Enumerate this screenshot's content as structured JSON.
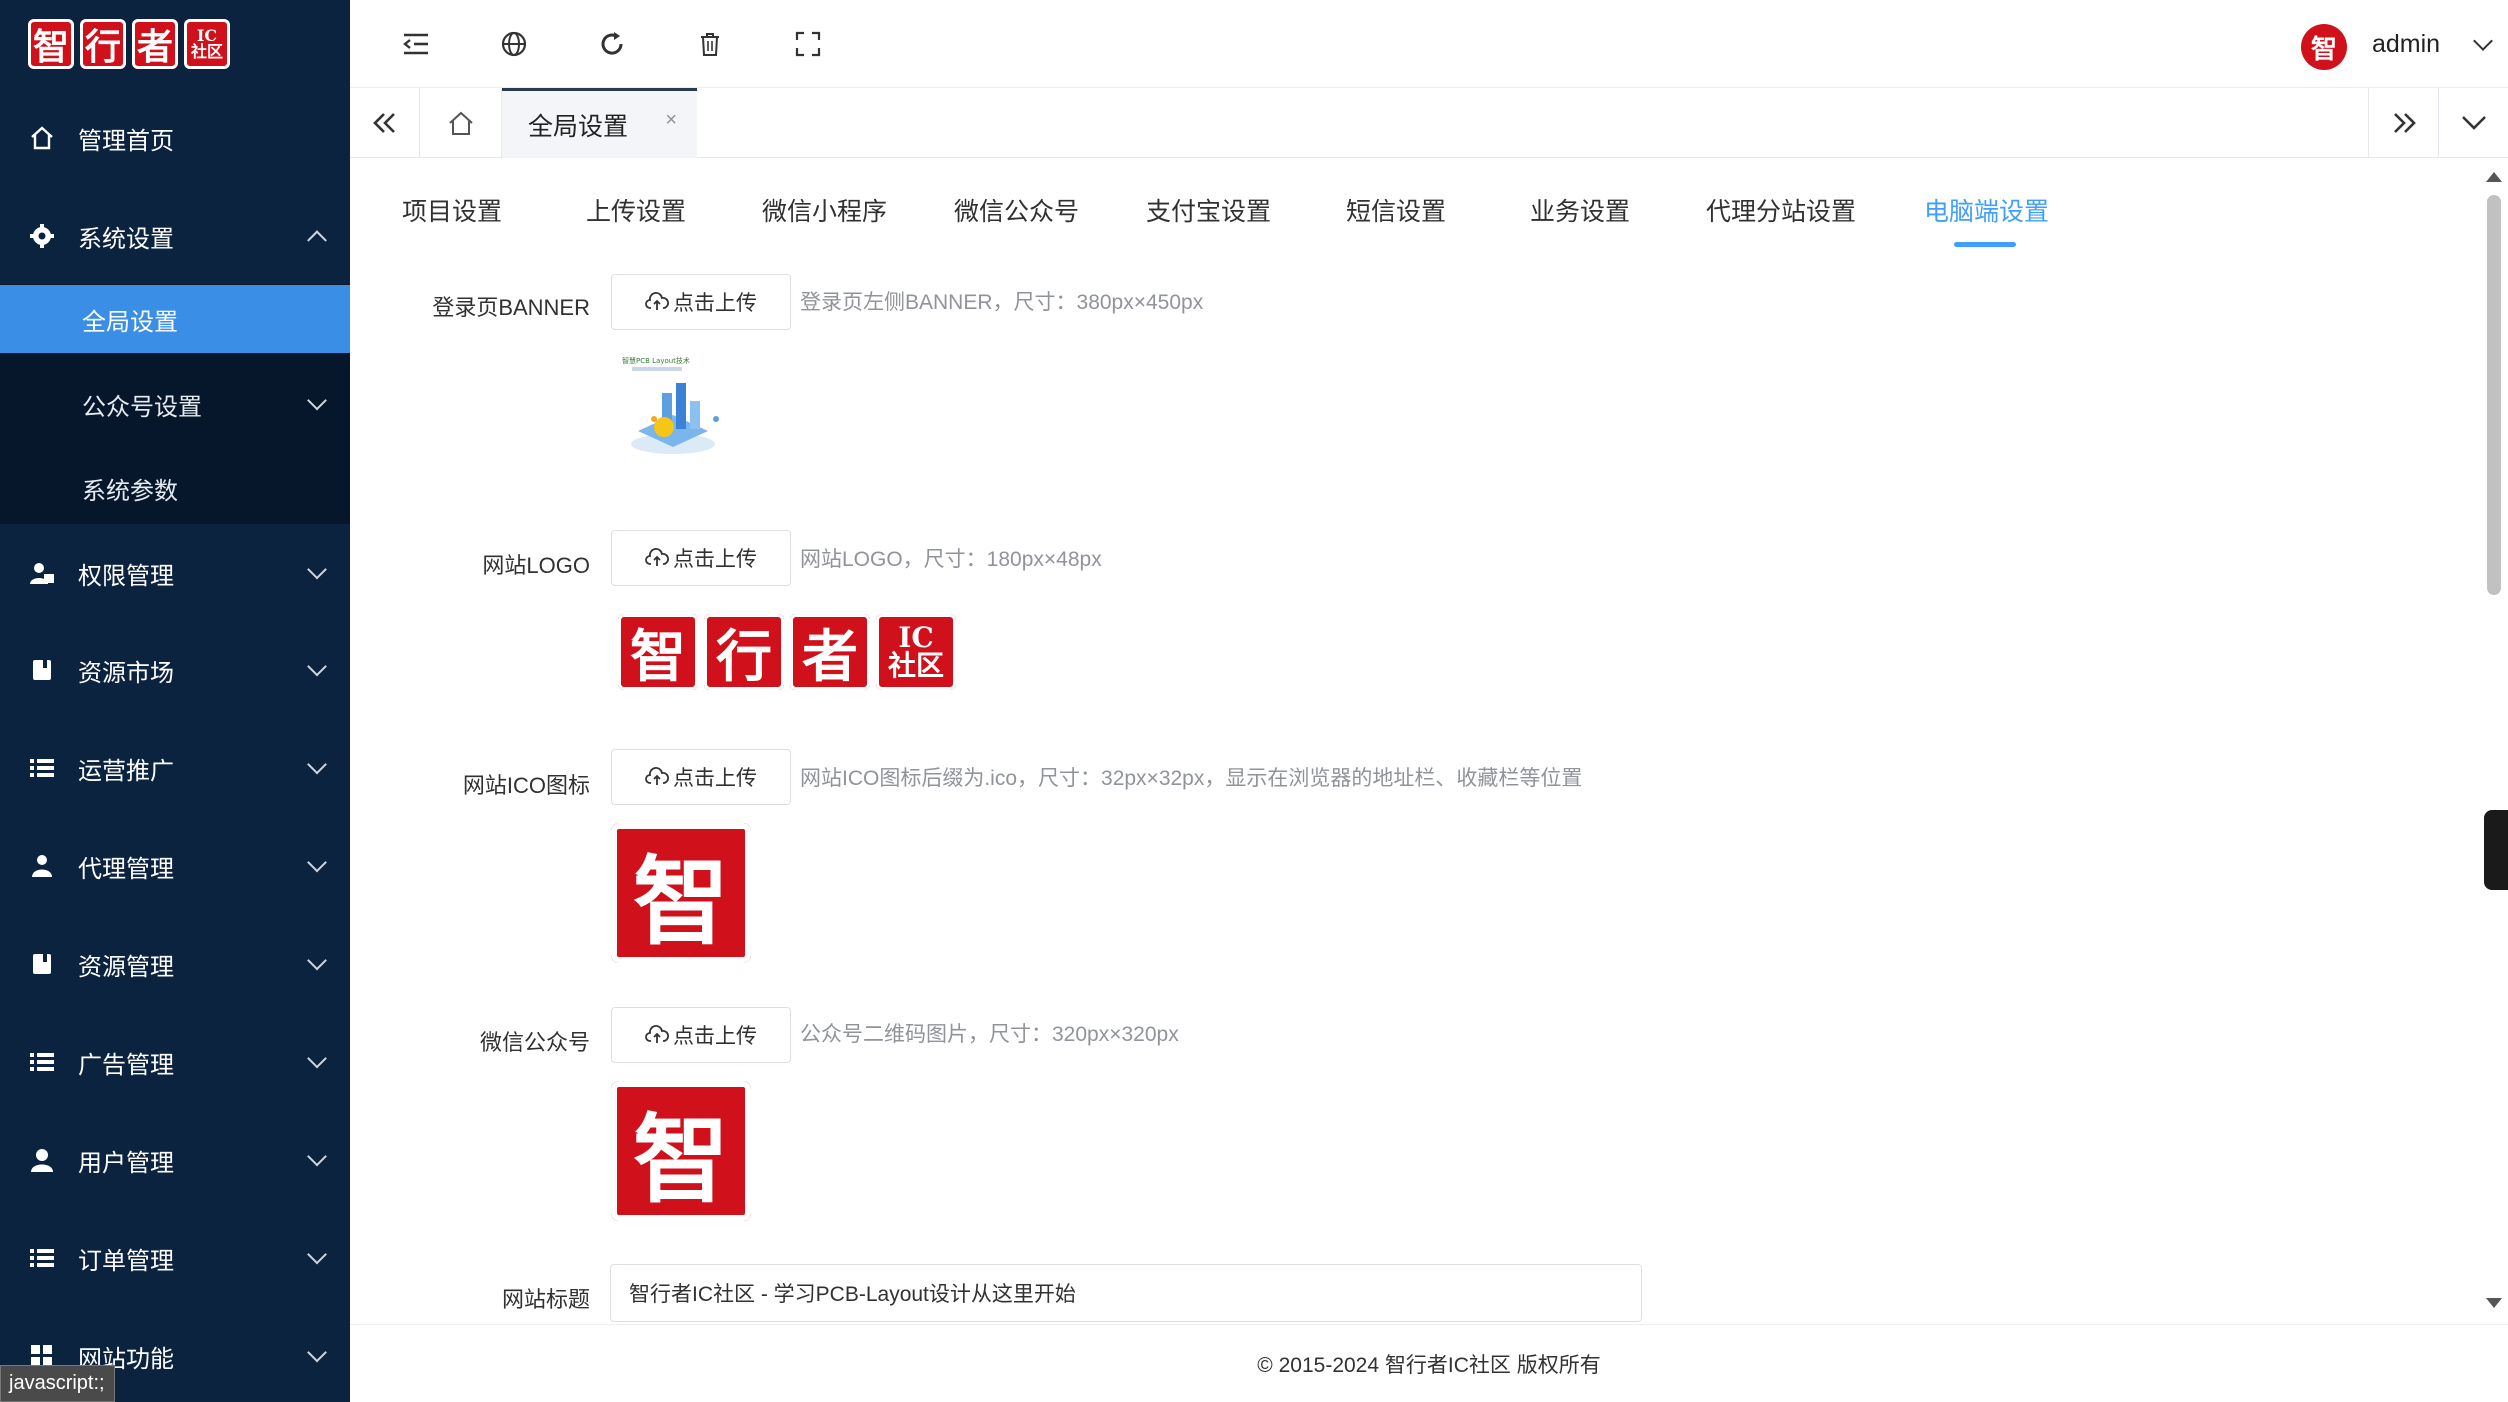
{
  "brand": {
    "logo_chars": [
      "智",
      "行",
      "者"
    ],
    "logo_small_top": "IC",
    "logo_small_bottom": "社区",
    "accent_red": "#d0101b"
  },
  "sidebar": {
    "bg_color": "#0c2340",
    "active_color": "#3a8ee6",
    "items": [
      {
        "label": "管理首页",
        "icon": "home-icon"
      },
      {
        "label": "系统设置",
        "icon": "gear-icon",
        "expanded": true
      },
      {
        "label": "权限管理",
        "icon": "user-lock-icon"
      },
      {
        "label": "资源市场",
        "icon": "book-icon"
      },
      {
        "label": "运营推广",
        "icon": "list-icon"
      },
      {
        "label": "代理管理",
        "icon": "agent-icon"
      },
      {
        "label": "资源管理",
        "icon": "book-icon"
      },
      {
        "label": "广告管理",
        "icon": "list-icon"
      },
      {
        "label": "用户管理",
        "icon": "user-icon"
      },
      {
        "label": "订单管理",
        "icon": "list-icon"
      },
      {
        "label": "网站功能",
        "icon": "grid-icon"
      }
    ],
    "sub_items": [
      {
        "label": "全局设置",
        "active": true
      },
      {
        "label": "公众号设置",
        "has_children": true
      },
      {
        "label": "系统参数"
      }
    ]
  },
  "status_bar_text": "javascript:;",
  "header": {
    "username": "admin",
    "avatar_char": "智"
  },
  "tags": {
    "active_tag": "全局设置",
    "close_symbol": "×"
  },
  "settings_tabs": [
    {
      "label": "项目设置"
    },
    {
      "label": "上传设置"
    },
    {
      "label": "微信小程序"
    },
    {
      "label": "微信公众号"
    },
    {
      "label": "支付宝设置"
    },
    {
      "label": "短信设置"
    },
    {
      "label": "业务设置"
    },
    {
      "label": "代理分站设置"
    },
    {
      "label": "电脑端设置",
      "active": true
    }
  ],
  "form": {
    "upload_label": "点击上传",
    "fields": [
      {
        "label": "登录页BANNER",
        "hint": "登录页左侧BANNER，尺寸：380px×450px"
      },
      {
        "label": "网站LOGO",
        "hint": "网站LOGO，尺寸：180px×48px"
      },
      {
        "label": "网站ICO图标",
        "hint": "网站ICO图标后缀为.ico，尺寸：32px×32px，显示在浏览器的地址栏、收藏栏等位置"
      },
      {
        "label": "微信公众号",
        "hint": "公众号二维码图片，尺寸：320px×320px"
      }
    ],
    "title_field": {
      "label": "网站标题",
      "value": "智行者IC社区 - 学习PCB-Layout设计从这里开始"
    },
    "banner_thumb_text": "智慧PCB Layout技术"
  },
  "footer": {
    "copyright": "© 2015-2024 智行者IC社区 版权所有"
  }
}
